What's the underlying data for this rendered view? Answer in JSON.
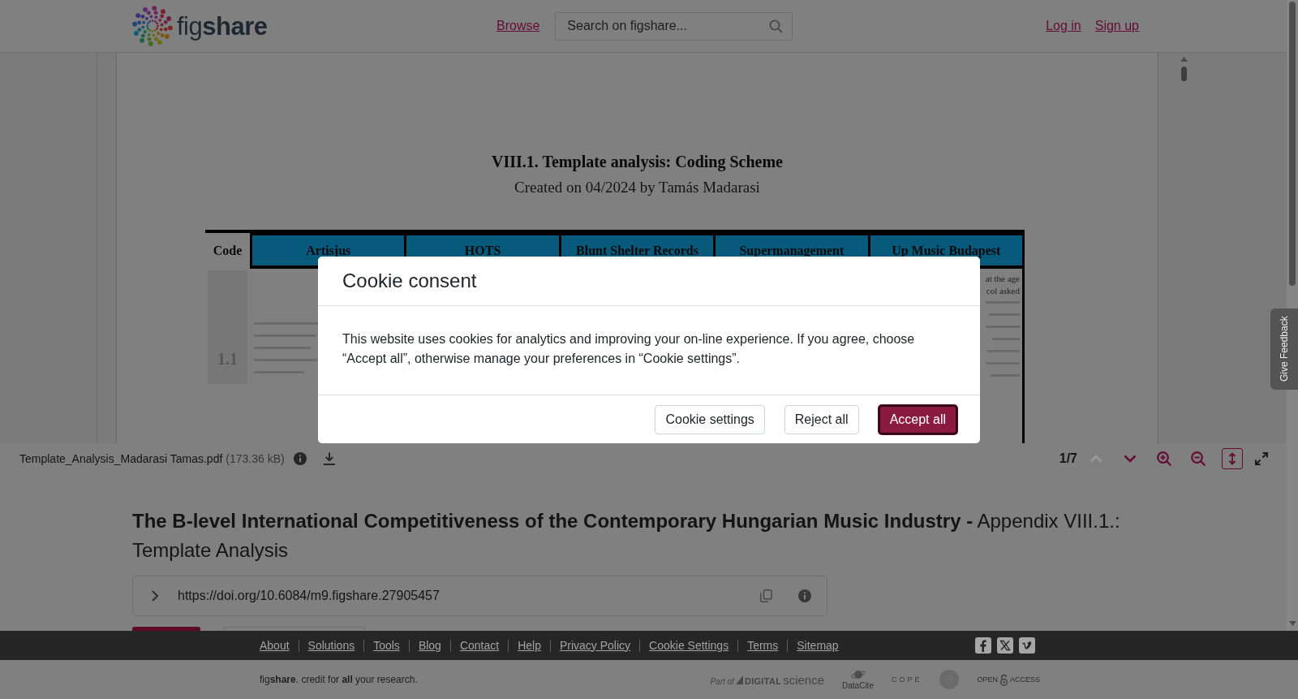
{
  "header": {
    "logo": "fig**share**",
    "nav": [
      {
        "label": "Browse"
      }
    ],
    "search": {
      "placeholder": "Search on figshare..."
    },
    "account_links": [
      {
        "label": "Log in"
      },
      {
        "label": "Sign up"
      }
    ]
  },
  "viewer": {
    "page": {
      "heading": "VIII.1. Template analysis: Coding Scheme",
      "subheading": "Created on 04/2024 by Tamás Madarasi",
      "table": {
        "columns": [
          "Code",
          "Artisjus",
          "HOTS",
          "Blunt Shelter Records",
          "Supermanagement",
          "Up Music Budapest"
        ],
        "rows": [
          {
            "code": "1.1",
            "last_cell_fragments": [
              "at the age",
              "col asked"
            ]
          }
        ]
      }
    }
  },
  "toolbar": {
    "file_name": "Template_Analysis_Madarasi Tamas.pdf",
    "file_size": "(173.36 kB)",
    "page_indicator": "1/7",
    "controls": [
      {
        "kind": "previous",
        "disabled": true,
        "on": false
      },
      {
        "kind": "next",
        "disabled": false,
        "on": false
      },
      {
        "kind": "zoom-in",
        "disabled": false,
        "on": false
      },
      {
        "kind": "zoom-out",
        "disabled": false,
        "on": false
      },
      {
        "kind": "fit-height",
        "disabled": false,
        "on": true
      },
      {
        "kind": "fullscreen",
        "disabled": false,
        "on": false
      }
    ]
  },
  "item": {
    "title": "**The B-level International Competitiveness of the Contemporary Hungarian Music Industry -** Appendix VIII.1.: Template Analysis",
    "doi": "https://doi.org/10.6084/m9.figshare.27905457"
  },
  "feedback_tab": {
    "label": "Give Feedback"
  },
  "footer": {
    "links": [
      "About",
      "Solutions",
      "Tools",
      "Blog",
      "Contact",
      "Help",
      "Privacy Policy",
      "Cookie Settings",
      "Terms",
      "Sitemap"
    ],
    "tagline": "fig**share**. credit for **all** your research.",
    "partner_logos": [
      {
        "kind": "digital-science",
        "prefix": "Part of",
        "name": "DIGITAL",
        "suffix": "science"
      },
      {
        "kind": "datacite",
        "name": "DataCite"
      },
      {
        "kind": "cope",
        "name": "COPE"
      },
      {
        "kind": "emblem"
      },
      {
        "kind": "open-access",
        "name": "OPEN",
        "suffix": "ACCESS"
      }
    ]
  },
  "cookie_dialog": {
    "title": "Cookie consent",
    "message": "This website uses cookies for analytics and improving your on-line experience. If you agree, choose “Accept all”, otherwise manage your preferences in “Cookie settings”.",
    "buttons": [
      {
        "label": "Cookie settings",
        "kind": "secondary",
        "focused": false
      },
      {
        "label": "Reject all",
        "kind": "secondary",
        "focused": false
      },
      {
        "label": "Accept all",
        "kind": "primary",
        "focused": true
      }
    ]
  }
}
